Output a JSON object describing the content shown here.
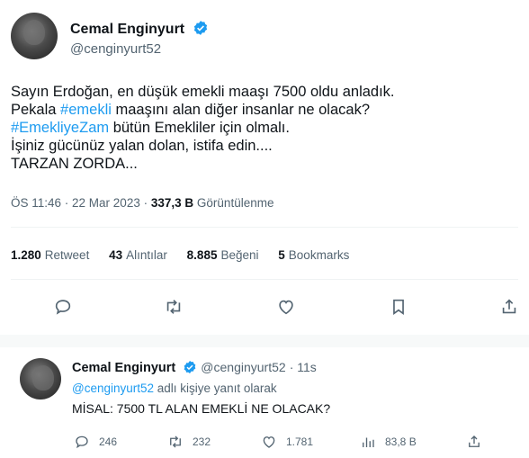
{
  "main_tweet": {
    "author_name": "Cemal Enginyurt",
    "author_handle": "@cenginyurt52",
    "text_lines": [
      {
        "before": "Sayın Erdoğan, en düşük emekli maaşı 7500 oldu anladık.",
        "tag": "",
        "after": ""
      },
      {
        "before": "Pekala ",
        "tag": "#emekli",
        "after": " maaşını alan diğer insanlar ne olacak?"
      },
      {
        "before": "",
        "tag": "#EmekliyeZam",
        "after": " bütün Emekliler için olmalı."
      },
      {
        "before": "İşiniz gücünüz yalan dolan, istifa edin....",
        "tag": "",
        "after": ""
      },
      {
        "before": "TARZAN ZORDA...",
        "tag": "",
        "after": ""
      }
    ],
    "timestamp": "ÖS 11:46 · 22 Mar 2023 ·",
    "views_count": "337,3 B",
    "views_label": "Görüntülenme",
    "stats": {
      "retweets_count": "1.280",
      "retweets_label": "Retweet",
      "quotes_count": "43",
      "quotes_label": "Alıntılar",
      "likes_count": "8.885",
      "likes_label": "Beğeni",
      "bookmarks_count": "5",
      "bookmarks_label": "Bookmarks"
    },
    "actions": [
      "reply-icon",
      "retweet-icon",
      "like-icon",
      "bookmark-icon",
      "share-icon"
    ]
  },
  "reply_tweet": {
    "author_name": "Cemal Enginyurt",
    "author_handle": "@cenginyurt52",
    "time": "· 11s",
    "reply_to_handle": "@cenginyurt52",
    "reply_to_suffix": "adlı kişiye yanıt olarak",
    "text": "MİSAL: 7500 TL ALAN EMEKLİ NE OLACAK?",
    "actions": {
      "reply_count": "246",
      "retweet_count": "232",
      "like_count": "1.781",
      "views_count": "83,8 B"
    }
  },
  "colors": {
    "accent": "#1d9bf0",
    "text": "#0f1419",
    "muted": "#536471"
  }
}
